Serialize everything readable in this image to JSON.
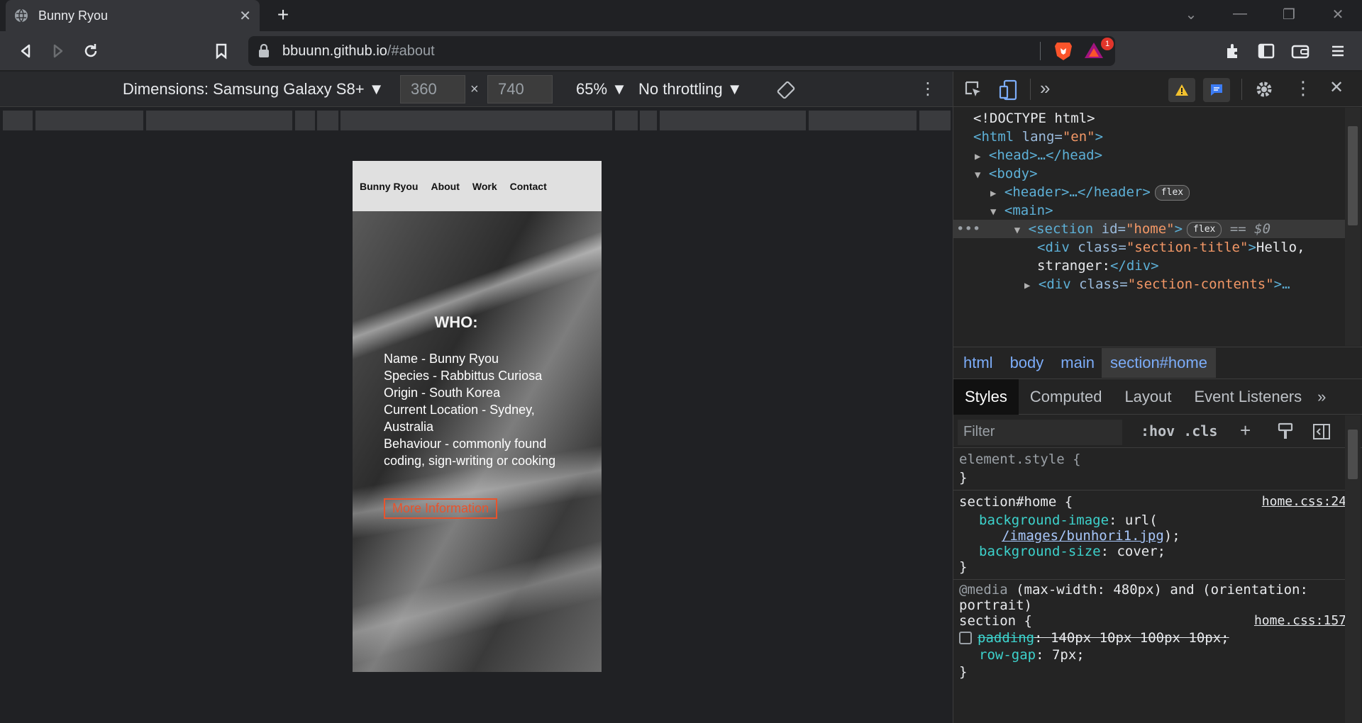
{
  "browser": {
    "tab_title": "Bunny Ryou",
    "new_tab_label": "+",
    "url_host": "bbuunn.github.io",
    "url_path": "/#about",
    "notification_count": "1"
  },
  "device_toolbar": {
    "dimensions_label": "Dimensions: Samsung Galaxy S8+",
    "width_value": "360",
    "height_value": "740",
    "times": "×",
    "zoom": "65%",
    "throttling": "No throttling"
  },
  "page": {
    "nav": [
      "Bunny Ryou",
      "About",
      "Work",
      "Contact"
    ],
    "section_title": "WHO:",
    "info_lines": [
      "Name - Bunny Ryou",
      "Species - Rabbittus Curiosa",
      "Origin - South Korea",
      "Current Location - Sydney, Australia",
      "Behaviour - commonly found coding, sign-writing or cooking"
    ],
    "button_label": "More Information",
    "accent_color": "#e8532c"
  },
  "devtools": {
    "dom": {
      "doctype": "<!DOCTYPE html>",
      "html_open": "<html",
      "html_attr": " lang=",
      "html_attr_val": "\"en\"",
      "html_close": ">",
      "head": "<head>…</head>",
      "body": "<body>",
      "header": "<header>…</header>",
      "header_pill": "flex",
      "main": "<main>",
      "section_open": "<section",
      "section_attr": " id=",
      "section_attr_val": "\"home\"",
      "section_close": ">",
      "section_pill": "flex",
      "section_eq": "== $0",
      "div1_open": "<div",
      "div1_attr": " class=",
      "div1_attr_val": "\"section-title\"",
      "div1_text": "Hello,",
      "div1_text2": "stranger:",
      "div1_close": "</div>",
      "div2_open": "<div",
      "div2_attr": " class=",
      "div2_attr_val": "\"section-contents\"",
      "div2_rest": ">…"
    },
    "breadcrumbs": [
      "html",
      "body",
      "main",
      "section#home"
    ],
    "style_tabs": [
      "Styles",
      "Computed",
      "Layout",
      "Event Listeners"
    ],
    "filter_placeholder": "Filter",
    "filter_hov": ":hov",
    "filter_cls": ".cls",
    "rules": {
      "element_style": "element.style {",
      "close_brace": "}",
      "r1_selector": "section#home {",
      "r1_source": "home.css:24",
      "r1_p1_name": "background-image",
      "r1_p1_val": ": url(",
      "r1_p1_link": "/images/bunhori1.jpg",
      "r1_p1_end": ");",
      "r1_p2_name": "background-size",
      "r1_p2_val": ": cover;",
      "r2_media_kw": "@media",
      "r2_media_q": " (max-width: 480px) and (orientation:",
      "r2_media_q2": "portrait)",
      "r2_selector": "section {",
      "r2_source": "home.css:157",
      "r2_p1_name": "padding",
      "r2_p1_val": ": 140px 10px 100px 10px;",
      "r2_p2_name": "row-gap",
      "r2_p2_val": ": 7px;"
    }
  }
}
